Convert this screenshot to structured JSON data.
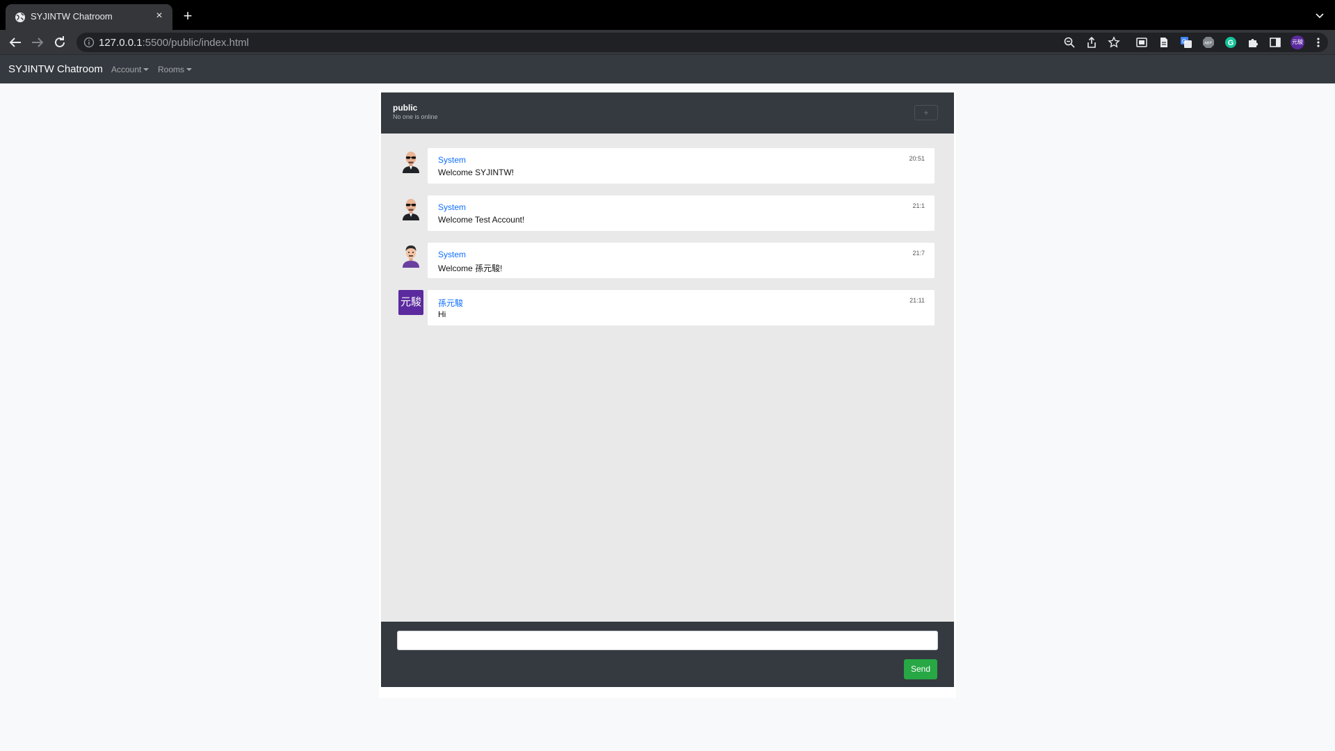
{
  "browser": {
    "tab_title": "SYJINTW Chatroom",
    "tab_close": "×",
    "new_tab": "+",
    "url_host": "127.0.0.1",
    "url_rest": ":5500/public/index.html",
    "profile_label": "元駿"
  },
  "navbar": {
    "brand": "SYJINTW Chatroom",
    "account_label": "Account",
    "rooms_label": "Rooms"
  },
  "room": {
    "name": "public",
    "status": "No one is online",
    "add_label": "+"
  },
  "messages": [
    {
      "sender": "System",
      "text": "Welcome SYJINTW!",
      "time": "20:51",
      "avatar": "bald-man-sunglasses-avatar"
    },
    {
      "sender": "System",
      "text": "Welcome Test Account!",
      "time": "21:1",
      "avatar": "bald-man-sunglasses-avatar"
    },
    {
      "sender": "System",
      "text": "Welcome 孫元駿!",
      "time": "21:7",
      "avatar": "man-purple-shirt-avatar"
    },
    {
      "sender": "孫元駿",
      "text": "Hi",
      "time": "21:11",
      "avatar_text": "元駿"
    }
  ],
  "composer": {
    "input_value": "",
    "send_label": "Send"
  },
  "colors": {
    "navbar": "#343a40",
    "sender_link": "#0d6efd",
    "send_button": "#28a745",
    "user_avatar": "#5b2a9e"
  }
}
